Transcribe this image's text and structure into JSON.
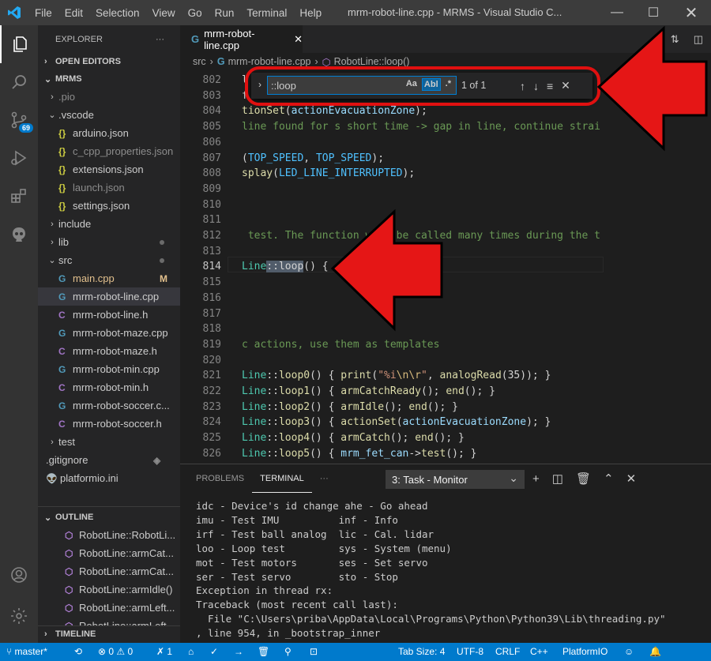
{
  "titlebar": {
    "menu": [
      "File",
      "Edit",
      "Selection",
      "View",
      "Go",
      "Run",
      "Terminal",
      "Help"
    ],
    "title": "mrm-robot-line.cpp - MRMS - Visual Studio C..."
  },
  "activity": {
    "scm_badge": "69"
  },
  "explorer": {
    "header": "EXPLORER",
    "header_more": "···",
    "open_editors": "OPEN EDITORS",
    "workspace": "MRMS",
    "items": [
      {
        "label": ".pio",
        "twisty": "›",
        "indent": 0,
        "dim": true
      },
      {
        "label": ".vscode",
        "twisty": "⌄",
        "indent": 0
      },
      {
        "label": "arduino.json",
        "icon": "{}",
        "type": "json",
        "indent": 1
      },
      {
        "label": "c_cpp_properties.json",
        "icon": "{}",
        "type": "json",
        "indent": 1,
        "dim": true
      },
      {
        "label": "extensions.json",
        "icon": "{}",
        "type": "json",
        "indent": 1
      },
      {
        "label": "launch.json",
        "icon": "{}",
        "type": "json",
        "indent": 1,
        "dim": true
      },
      {
        "label": "settings.json",
        "icon": "{}",
        "type": "json",
        "indent": 1
      },
      {
        "label": "include",
        "twisty": "›",
        "indent": 0
      },
      {
        "label": "lib",
        "twisty": "›",
        "indent": 0,
        "dot": true
      },
      {
        "label": "src",
        "twisty": "⌄",
        "indent": 0,
        "dot": true
      },
      {
        "label": "main.cpp",
        "icon": "G",
        "type": "cpp",
        "indent": 1,
        "git": "M",
        "mod": true
      },
      {
        "label": "mrm-robot-line.cpp",
        "icon": "G",
        "type": "cpp",
        "indent": 1,
        "selected": true
      },
      {
        "label": "mrm-robot-line.h",
        "icon": "C",
        "type": "h",
        "indent": 1
      },
      {
        "label": "mrm-robot-maze.cpp",
        "icon": "G",
        "type": "cpp",
        "indent": 1
      },
      {
        "label": "mrm-robot-maze.h",
        "icon": "C",
        "type": "h",
        "indent": 1
      },
      {
        "label": "mrm-robot-min.cpp",
        "icon": "G",
        "type": "cpp",
        "indent": 1
      },
      {
        "label": "mrm-robot-min.h",
        "icon": "C",
        "type": "h",
        "indent": 1
      },
      {
        "label": "mrm-robot-soccer.c...",
        "icon": "G",
        "type": "cpp",
        "indent": 1
      },
      {
        "label": "mrm-robot-soccer.h",
        "icon": "C",
        "type": "h",
        "indent": 1
      },
      {
        "label": "test",
        "twisty": "›",
        "indent": 0
      },
      {
        "label": ".gitignore",
        "icon": "◈",
        "type": "git",
        "indent": 0
      },
      {
        "label": "platformio.ini",
        "icon": "👽",
        "type": "pio",
        "indent": 0
      }
    ],
    "outline": "OUTLINE",
    "outline_items": [
      "RobotLine::RobotLi...",
      "RobotLine::armCat...",
      "RobotLine::armCat...",
      "RobotLine::armIdle()",
      "RobotLine::armLeft...",
      "RobotLine::armLeft..."
    ],
    "timeline": "TIMELINE"
  },
  "editor": {
    "tab_label": "mrm-robot-line.cpp",
    "breadcrumb": [
      "src",
      "mrm-robot-line.cpp",
      "RobotLine::loop()"
    ]
  },
  "code_lines": [
    {
      "n": "802",
      "html": "l"
    },
    {
      "n": "803",
      "html": "f"
    },
    {
      "n": "804",
      "html": "tionSet(actionEvacuationZone);"
    },
    {
      "n": "805",
      "html": "line found for s short time -> gap in line, continue strai"
    },
    {
      "n": "806",
      "html": ""
    },
    {
      "n": "807",
      "html": "(TOP_SPEED, TOP_SPEED);"
    },
    {
      "n": "808",
      "html": "splay(LED_LINE_INTERRUPTED);"
    },
    {
      "n": "809",
      "html": ""
    },
    {
      "n": "810",
      "html": ""
    },
    {
      "n": "811",
      "html": ""
    },
    {
      "n": "812",
      "html": " test. The function will be called many times during the t"
    },
    {
      "n": "813",
      "html": ""
    },
    {
      "n": "814",
      "html": "Line::loop() {"
    },
    {
      "n": "815",
      "html": ""
    },
    {
      "n": "816",
      "html": ""
    },
    {
      "n": "817",
      "html": ""
    },
    {
      "n": "818",
      "html": ""
    },
    {
      "n": "819",
      "html": "c actions, use them as templates"
    },
    {
      "n": "820",
      "html": ""
    },
    {
      "n": "821",
      "html": "Line::loop0() { print(\"%i\\n\\r\", analogRead(35)); }"
    },
    {
      "n": "822",
      "html": "Line::loop1() { armCatchReady(); end(); }"
    },
    {
      "n": "823",
      "html": "Line::loop2() { armIdle(); end(); }"
    },
    {
      "n": "824",
      "html": "Line::loop3() { actionSet(actionEvacuationZone); }"
    },
    {
      "n": "825",
      "html": "Line::loop4() { armCatch(); end(); }"
    },
    {
      "n": "826",
      "html": "Line::loop5() { mrm_fet_can->test(); }"
    }
  ],
  "find": {
    "value": "::loop",
    "match_case": "Aa",
    "whole_word": "Abl",
    "regex": ".*",
    "count": "1 of 1"
  },
  "panel": {
    "tabs": [
      "PROBLEMS",
      "TERMINAL",
      "···"
    ],
    "task": "3: Task - Monitor",
    "terminal_lines": [
      "idc - Device's id change ahe - Go ahead",
      "imu - Test IMU          inf - Info",
      "irf - Test ball analog  lic - Cal. lidar",
      "loo - Loop test         sys - System (menu)",
      "mot - Test motors       ses - Set servo",
      "ser - Test servo        sto - Stop",
      "Exception in thread rx:",
      "Traceback (most recent call last):",
      "  File \"C:\\Users\\priba\\AppData\\Local\\Programs\\Python\\Python39\\Lib\\threading.py\"",
      ", line 954, in _bootstrap_inner"
    ]
  },
  "status": {
    "branch": "master*",
    "errors": "0",
    "warnings": "0",
    "tasks": "1",
    "tab_size": "Tab Size: 4",
    "encoding": "UTF-8",
    "eol": "CRLF",
    "language": "C++",
    "platform": "PlatformIO"
  }
}
